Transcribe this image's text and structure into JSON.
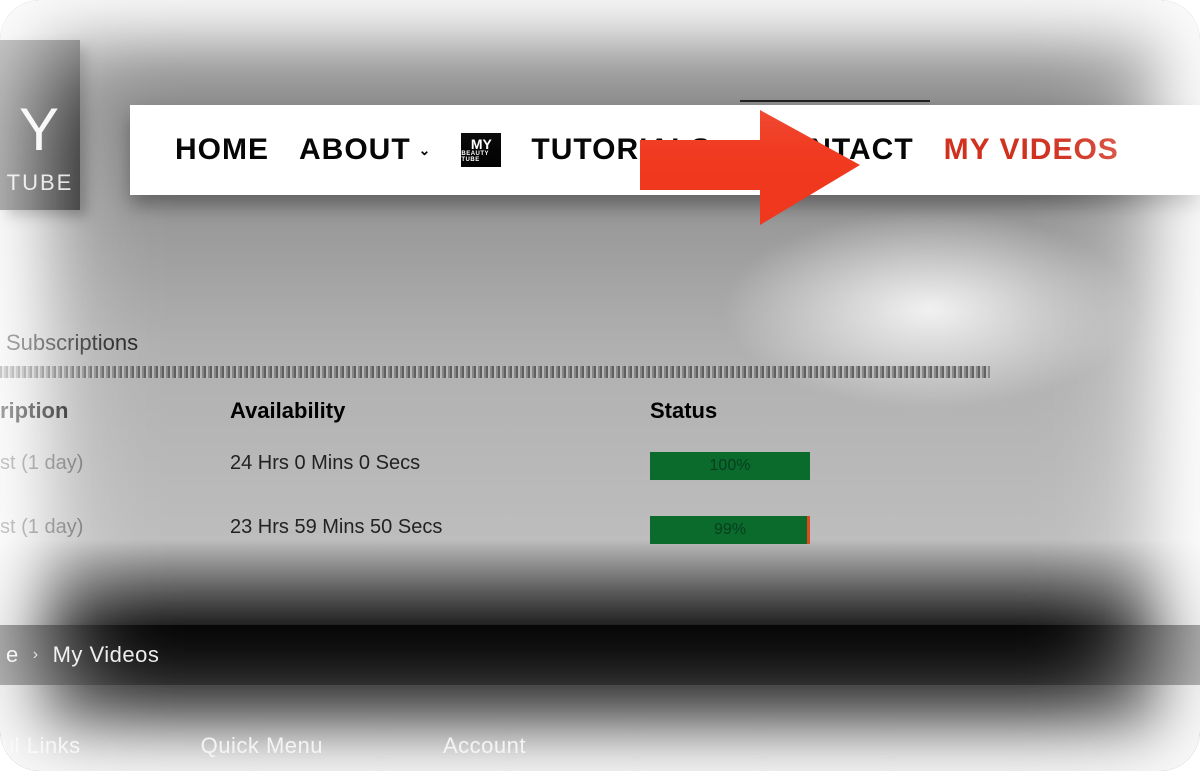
{
  "logo": {
    "glyph": "Y",
    "text": "TUBE"
  },
  "nav": {
    "home": "HOME",
    "about": "ABOUT",
    "badge_top": "MY",
    "badge_bottom": "BEAUTY TUBE",
    "tutorials": "TUTORIALS",
    "contact": "CONTACT",
    "my_videos": "MY VIDEOS"
  },
  "subscriptions": {
    "title": "Subscriptions",
    "headers": {
      "subscription": "ription",
      "availability": "Availability",
      "status": "Status"
    },
    "rows": [
      {
        "sub": "st (1 day)",
        "avail": "24 Hrs 0 Mins 0 Secs",
        "status_pct": "100%",
        "has_tick": false
      },
      {
        "sub": "st (1 day)",
        "avail": "23 Hrs 59 Mins 50 Secs",
        "status_pct": "99%",
        "has_tick": true
      }
    ]
  },
  "breadcrumb": {
    "first": "e",
    "sep": "›",
    "second": "My Videos"
  },
  "footer": {
    "col1": "ul Links",
    "col2": "Quick Menu",
    "col3": "Account"
  }
}
